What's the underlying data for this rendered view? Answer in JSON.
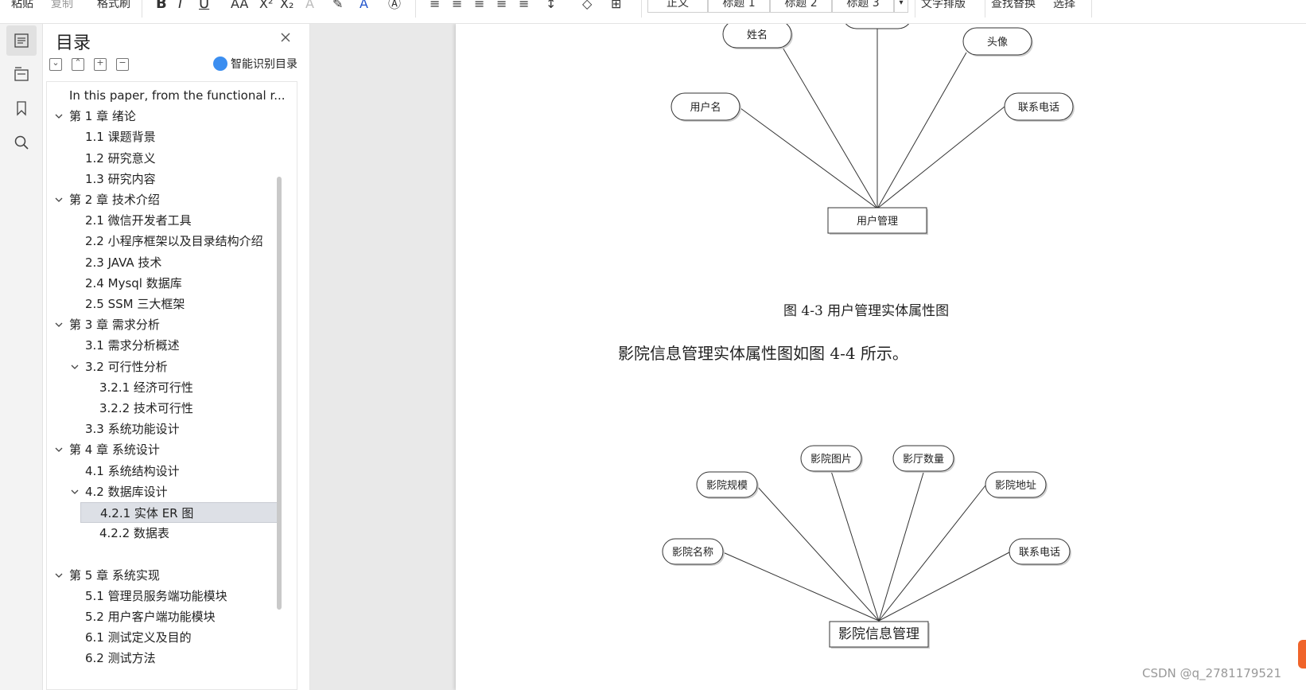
{
  "toolbar": {
    "paste_label": "粘贴",
    "copy_label": "复制",
    "format_painter_label": "格式刷",
    "bold_label": "B",
    "italic_label": "I",
    "underline_label": "U",
    "styles": [
      "正文",
      "标题 1",
      "标题 2",
      "标题 3"
    ],
    "text_layout_label": "文字排版",
    "find_replace_label": "查找替换",
    "select_label": "选择"
  },
  "toc": {
    "title": "目录",
    "smart_label": "智能识别目录",
    "items": [
      {
        "label": "In this paper, from the functional r...",
        "level": 0,
        "caret": "",
        "selected": false
      },
      {
        "label": "第 1 章  绪论",
        "level": 1,
        "caret": "down",
        "selected": false
      },
      {
        "label": "1.1 课题背景",
        "level": 2,
        "caret": "",
        "selected": false
      },
      {
        "label": "1.2 研究意义",
        "level": 2,
        "caret": "",
        "selected": false
      },
      {
        "label": "1.3 研究内容",
        "level": 2,
        "caret": "",
        "selected": false
      },
      {
        "label": "第 2 章  技术介绍",
        "level": 1,
        "caret": "down",
        "selected": false
      },
      {
        "label": "2.1 微信开发者工具",
        "level": 2,
        "caret": "",
        "selected": false
      },
      {
        "label": "2.2 小程序框架以及目录结构介绍",
        "level": 2,
        "caret": "",
        "selected": false
      },
      {
        "label": "2.3 JAVA 技术",
        "level": 2,
        "caret": "",
        "selected": false
      },
      {
        "label": "2.4   Mysql 数据库",
        "level": 2,
        "caret": "",
        "selected": false
      },
      {
        "label": "2.5 SSM 三大框架",
        "level": 2,
        "caret": "",
        "selected": false
      },
      {
        "label": "第 3 章  需求分析",
        "level": 1,
        "caret": "down",
        "selected": false
      },
      {
        "label": "3.1 需求分析概述",
        "level": 2,
        "caret": "",
        "selected": false
      },
      {
        "label": "3.2 可行性分析",
        "level": 2,
        "caret": "down",
        "selected": false
      },
      {
        "label": "3.2.1 经济可行性",
        "level": 3,
        "caret": "",
        "selected": false
      },
      {
        "label": "3.2.2 技术可行性",
        "level": 3,
        "caret": "",
        "selected": false
      },
      {
        "label": "3.3 系统功能设计",
        "level": 2,
        "caret": "",
        "selected": false
      },
      {
        "label": "第 4 章  系统设计",
        "level": 1,
        "caret": "down",
        "selected": false
      },
      {
        "label": "4.1 系统结构设计",
        "level": 2,
        "caret": "",
        "selected": false
      },
      {
        "label": "4.2 数据库设计",
        "level": 2,
        "caret": "down",
        "selected": false
      },
      {
        "label": "4.2.1 实体 ER 图",
        "level": 3,
        "caret": "",
        "selected": true
      },
      {
        "label": "4.2.2 数据表",
        "level": 3,
        "caret": "",
        "selected": false
      },
      {
        "label": "",
        "level": 0,
        "caret": "",
        "selected": false
      },
      {
        "label": "第 5 章  系统实现",
        "level": 1,
        "caret": "down",
        "selected": false
      },
      {
        "label": "5.1 管理员服务端功能模块",
        "level": 2,
        "caret": "",
        "selected": false
      },
      {
        "label": "5.2 用户客户端功能模块",
        "level": 2,
        "caret": "",
        "selected": false
      },
      {
        "label": "6.1 测试定义及目的",
        "level": 2,
        "caret": "",
        "selected": false
      },
      {
        "label": "6.2 测试方法",
        "level": 2,
        "caret": "",
        "selected": false
      }
    ]
  },
  "document": {
    "diagram1": {
      "entity": "用户管理",
      "attributes": [
        "姓名",
        "头像",
        "用户名",
        "联系电话"
      ],
      "caption": "图 4-3 用户管理实体属性图"
    },
    "paragraph": "影院信息管理实体属性图如图 4-4 所示。",
    "diagram2": {
      "entity": "影院信息管理",
      "attributes": [
        "影院图片",
        "影厅数量",
        "影院规模",
        "影院地址",
        "影院名称",
        "联系电话"
      ]
    }
  },
  "watermark": "CSDN @q_2781179521",
  "colors": {
    "selection": "#dde0e6",
    "accent": "#3b8ef0",
    "orange": "#f0642a"
  }
}
